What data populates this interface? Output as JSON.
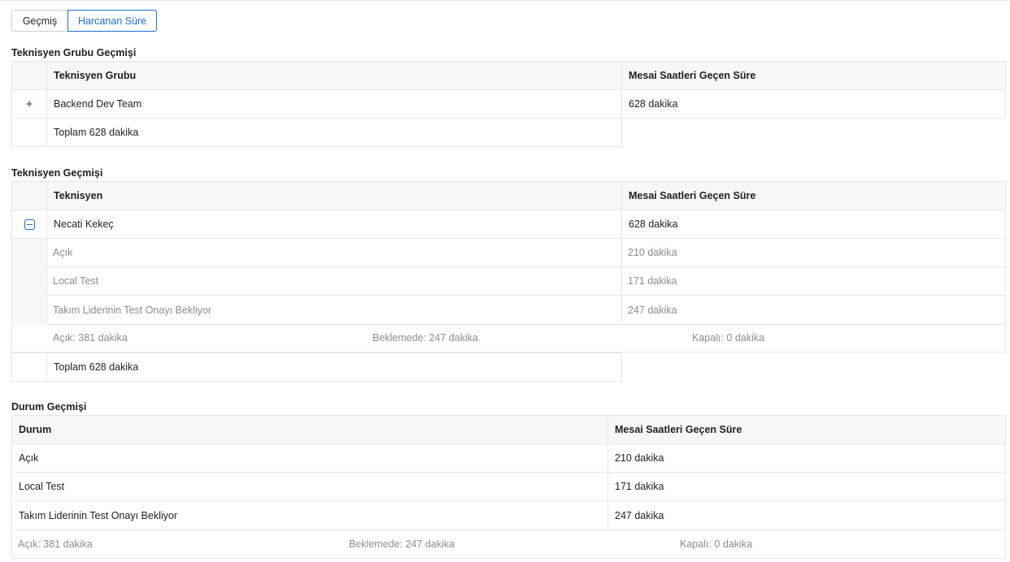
{
  "tabs": [
    {
      "label": "Geçmiş",
      "active": false
    },
    {
      "label": "Harcanan Süre",
      "active": true
    }
  ],
  "accent_color": "#1f6fd1",
  "group_history": {
    "title": "Teknisyen Grubu Geçmişi",
    "columns": [
      "Teknisyen Grubu",
      "Mesai Saatleri Geçen Süre"
    ],
    "rows": [
      {
        "name": "Backend Dev Team",
        "time": "628 dakika",
        "expander": "plus-icon"
      }
    ],
    "total": "Toplam 628 dakika"
  },
  "technician_history": {
    "title": "Teknisyen Geçmişi",
    "columns": [
      "Teknisyen",
      "Mesai Saatleri Geçen Süre"
    ],
    "rows": [
      {
        "name": "Necati Kekeç",
        "time": "628 dakika",
        "expander": "minus-square-icon"
      }
    ],
    "sub_rows": [
      {
        "name": "Açık",
        "time": "210 dakika"
      },
      {
        "name": "Local Test",
        "time": "171 dakika"
      },
      {
        "name": "Takım Liderinin Test Onayı Bekliyor",
        "time": "247 dakika"
      }
    ],
    "summary": {
      "open": "Açık: 381 dakika",
      "waiting": "Beklemede: 247 dakika",
      "closed": "Kapalı: 0 dakika"
    },
    "total": "Toplam 628 dakika"
  },
  "status_history": {
    "title": "Durum Geçmişi",
    "columns": [
      "Durum",
      "Mesai Saatleri Geçen Süre"
    ],
    "rows": [
      {
        "name": "Açık",
        "time": "210 dakika"
      },
      {
        "name": "Local Test",
        "time": "171 dakika"
      },
      {
        "name": "Takım Liderinin Test Onayı Bekliyor",
        "time": "247 dakika"
      }
    ],
    "summary": {
      "open": "Açık: 381 dakika",
      "waiting": "Beklemede: 247 dakika",
      "closed": "Kapalı: 0 dakika"
    }
  }
}
